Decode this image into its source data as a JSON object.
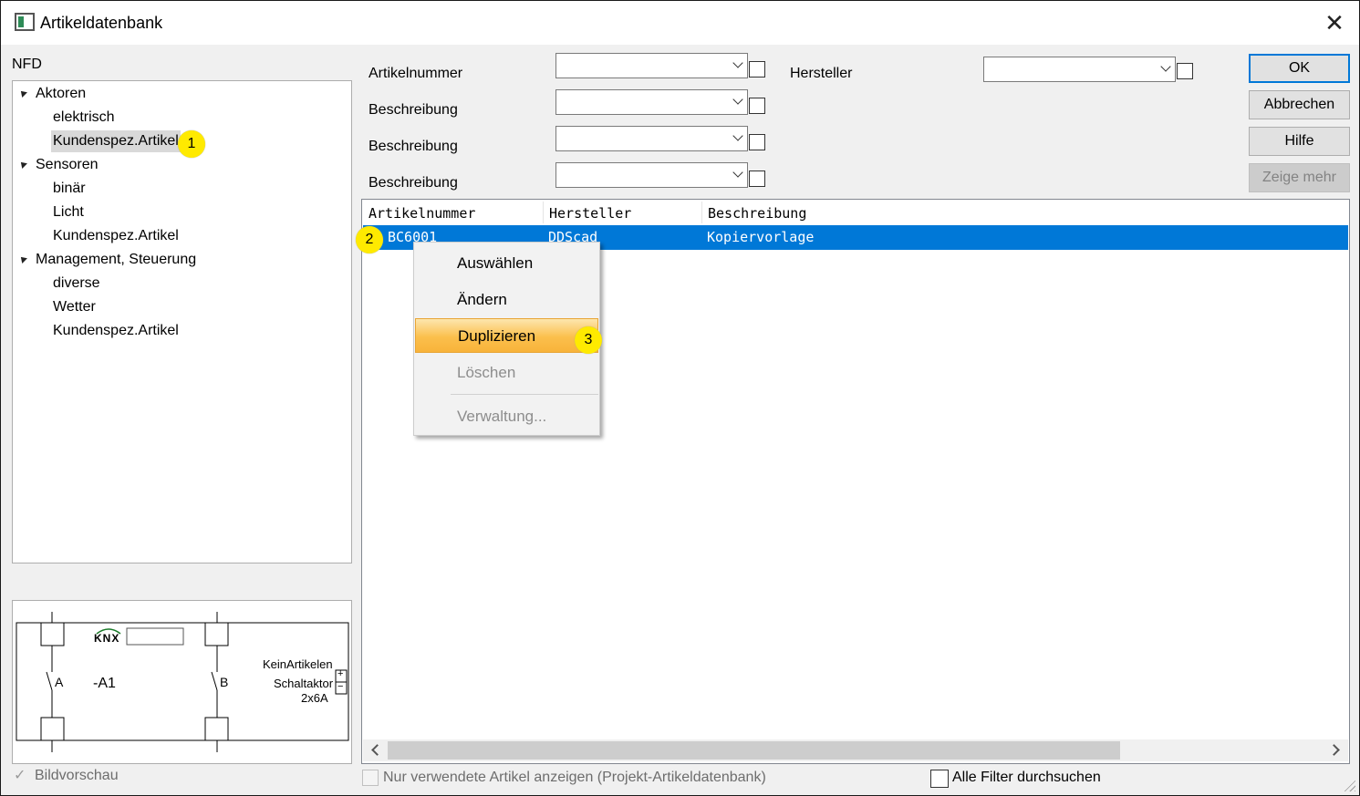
{
  "window": {
    "title": "Artikeldatenbank",
    "close_glyph": "✕"
  },
  "tree": {
    "root_label": "NFD",
    "nodes": [
      {
        "label": "Aktoren",
        "level": 0
      },
      {
        "label": "elektrisch",
        "level": 1
      },
      {
        "label": "Kundenspez.Artikel",
        "level": 1,
        "selected": true
      },
      {
        "label": "Sensoren",
        "level": 0
      },
      {
        "label": "binär",
        "level": 1
      },
      {
        "label": "Licht",
        "level": 1
      },
      {
        "label": "Kundenspez.Artikel",
        "level": 1
      },
      {
        "label": "Management, Steuerung",
        "level": 0
      },
      {
        "label": "diverse",
        "level": 1
      },
      {
        "label": "Wetter",
        "level": 1
      },
      {
        "label": "Kundenspez.Artikel",
        "level": 1
      }
    ]
  },
  "filters": {
    "artikelnummer_label": "Artikelnummer",
    "beschreibung_label_1": "Beschreibung",
    "beschreibung_label_2": "Beschreibung",
    "beschreibung_label_3": "Beschreibung",
    "hersteller_label": "Hersteller"
  },
  "buttons": {
    "ok": "OK",
    "cancel": "Abbrechen",
    "help": "Hilfe",
    "more": "Zeige mehr"
  },
  "grid": {
    "columns": [
      "Artikelnummer",
      "Hersteller",
      "Beschreibung"
    ],
    "rows": [
      {
        "artikelnummer": "BC6001",
        "hersteller": "DDScad",
        "beschreibung": "Kopiervorlage"
      }
    ]
  },
  "context_menu": {
    "items": [
      "Auswählen",
      "Ändern",
      "Duplizieren",
      "Löschen",
      "Verwaltung..."
    ],
    "highlighted": "Duplizieren",
    "disabled": [
      "Löschen",
      "Verwaltung..."
    ]
  },
  "badges": {
    "one": "1",
    "two": "2",
    "three": "3"
  },
  "preview": {
    "knx_logo": "KNX",
    "designator": "-A1",
    "contact_a": "A",
    "contact_b": "B",
    "text_line1": "KeinArtikelen",
    "text_line2": "Schaltaktor",
    "text_line3": "2x6A",
    "plus": "+",
    "minus": "−"
  },
  "footer": {
    "bildvorschau": "Bildvorschau",
    "nur_verwendete": "Nur verwendete Artikel anzeigen (Projekt-Artikeldatenbank)",
    "alle_filter": "Alle Filter durchsuchen"
  },
  "colors": {
    "selection": "#0078d7",
    "badge": "#ffea00",
    "menu_highlight": "#fbbf4c"
  }
}
